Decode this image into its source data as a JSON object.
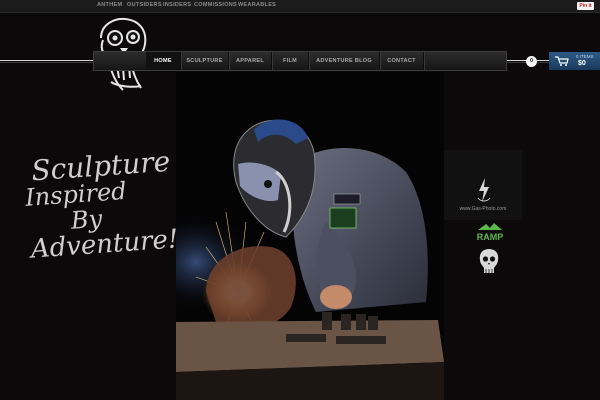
{
  "top_links": [
    "ANTHEM",
    "OUTSIDERS",
    "INSIDERS",
    "COMMISSIONS",
    "WEARABLES"
  ],
  "pinterest_label": "Pin it",
  "nav_items": [
    {
      "label": "HOME",
      "active": true
    },
    {
      "label": "SCULPTURE",
      "active": false
    },
    {
      "label": "APPAREL",
      "active": false
    },
    {
      "label": "FILM",
      "active": false
    },
    {
      "label": "ADVENTURE BLOG",
      "active": false
    },
    {
      "label": "CONTACT",
      "active": false
    }
  ],
  "cart": {
    "badge": "0",
    "count_text": "0 ITEMS",
    "amount": "$0"
  },
  "tagline": [
    "Sculpture",
    "Inspired",
    "By",
    "Adventure!"
  ],
  "sponsor": {
    "url": "www.Gas-Photo.com",
    "ramp": "RAMP"
  },
  "colors": {
    "background": "#0b090a",
    "cart_blue": "#1f466c",
    "ramp_green": "#5bb84a"
  },
  "icons": [
    "skull-logo-icon",
    "cart-icon",
    "lightning-bolt-icon",
    "skull-icon"
  ]
}
